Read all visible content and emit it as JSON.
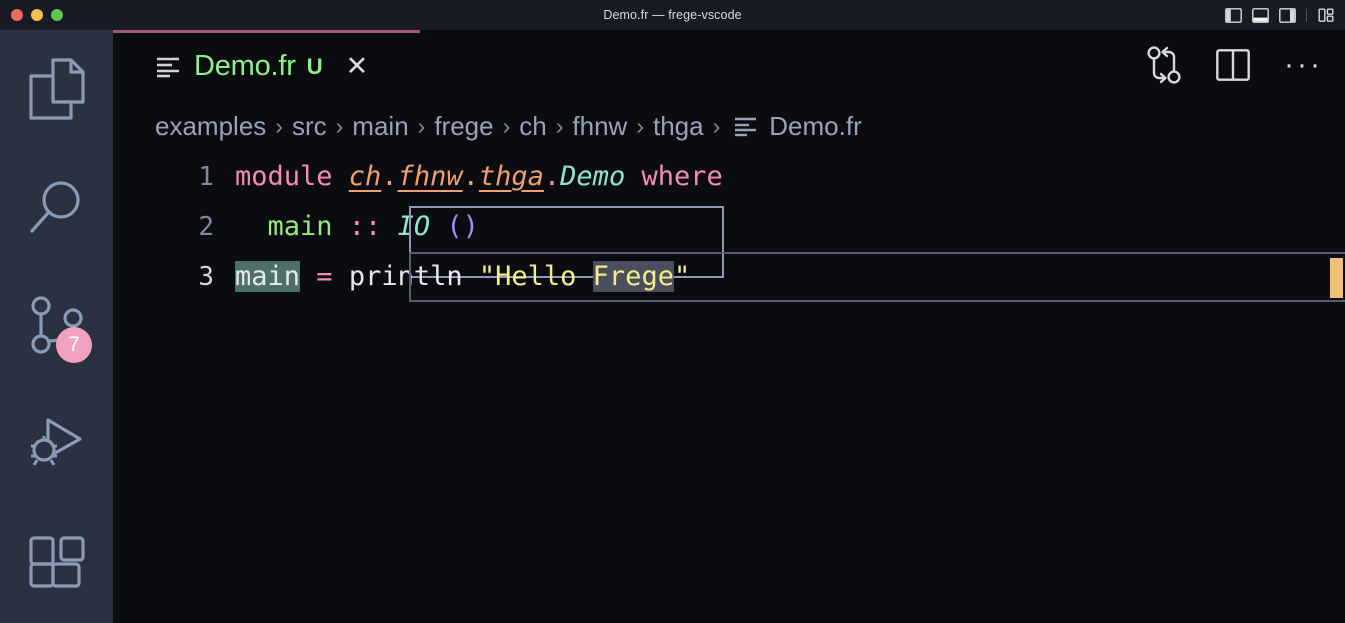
{
  "window": {
    "title": "Demo.fr — frege-vscode",
    "traffic_lights": [
      "close",
      "minimize",
      "zoom"
    ]
  },
  "layout_actions": [
    {
      "name": "toggle-primary-sidebar",
      "tooltip": "Toggle Primary Side Bar"
    },
    {
      "name": "toggle-panel",
      "tooltip": "Toggle Panel"
    },
    {
      "name": "toggle-secondary-sidebar",
      "tooltip": "Toggle Secondary Side Bar"
    },
    {
      "name": "customize-layout",
      "tooltip": "Customize Layout"
    }
  ],
  "activity_bar": {
    "items": [
      {
        "icon": "explorer-icon",
        "label": "Explorer",
        "badge": null
      },
      {
        "icon": "search-icon",
        "label": "Search",
        "badge": null
      },
      {
        "icon": "source-control-icon",
        "label": "Source Control",
        "badge": "7"
      },
      {
        "icon": "run-and-debug-icon",
        "label": "Run and Debug",
        "badge": null
      },
      {
        "icon": "extensions-icon",
        "label": "Extensions",
        "badge": null
      }
    ]
  },
  "tab": {
    "icon": "file-outline-icon",
    "label": "Demo.fr",
    "git_badge": "U",
    "close": "✕"
  },
  "editor_actions": [
    {
      "icon": "compare-changes-icon",
      "label": "Open Changes"
    },
    {
      "icon": "split-editor-icon",
      "label": "Split Editor Right"
    },
    {
      "icon": "more-actions-icon",
      "label": "···"
    }
  ],
  "breadcrumb": {
    "separator": "›",
    "items": [
      "examples",
      "src",
      "main",
      "frege",
      "ch",
      "fhnw",
      "thga"
    ],
    "file": "Demo.fr",
    "file_icon": "file-outline-icon"
  },
  "code": {
    "lines": [
      {
        "number": "1",
        "tokens": [
          {
            "text": "module ",
            "type": "keyword"
          },
          {
            "text": "ch",
            "type": "module"
          },
          {
            "text": ".",
            "type": "dot"
          },
          {
            "text": "fhnw",
            "type": "module"
          },
          {
            "text": ".",
            "type": "dot"
          },
          {
            "text": "thga",
            "type": "module"
          },
          {
            "text": ".",
            "type": "dot-pink"
          },
          {
            "text": "Demo",
            "type": "type"
          },
          {
            "text": " ",
            "type": "plain"
          },
          {
            "text": "where",
            "type": "keyword"
          }
        ]
      },
      {
        "number": "2",
        "tokens": [
          {
            "text": "main ",
            "type": "function"
          },
          {
            "text": ":: ",
            "type": "keyword"
          },
          {
            "text": "IO ",
            "type": "type"
          },
          {
            "text": "()",
            "type": "punct"
          }
        ]
      },
      {
        "number": "3",
        "tokens": [
          {
            "text": "main",
            "type": "plain-occurrence"
          },
          {
            "text": " ",
            "type": "plain"
          },
          {
            "text": "=",
            "type": "keyword"
          },
          {
            "text": " println ",
            "type": "plain"
          },
          {
            "text": "\"Hello ",
            "type": "string"
          },
          {
            "text": "Frege",
            "type": "string-selected"
          },
          {
            "text": "\"",
            "type": "string"
          }
        ]
      }
    ]
  },
  "colors": {
    "titlebar_bg": "#181b23",
    "activitybar_bg": "#2a3140",
    "editor_bg": "#0b0c10",
    "tab_top_border": "#a05878",
    "tab_label": "#8ff08a",
    "badge_bg": "#f2a0c0",
    "keyword_pink": "#f48cb4",
    "module_orange": "#f0a070",
    "type_mint": "#8ee6cd",
    "function_green": "#9ce87e",
    "punct_purple": "#a78bfa",
    "string_yellow": "#f5ee88",
    "occurrence_highlight": "#4d6f68",
    "selection_highlight": "#4a4e5e",
    "overview_ruler_mark": "#f2c078"
  }
}
